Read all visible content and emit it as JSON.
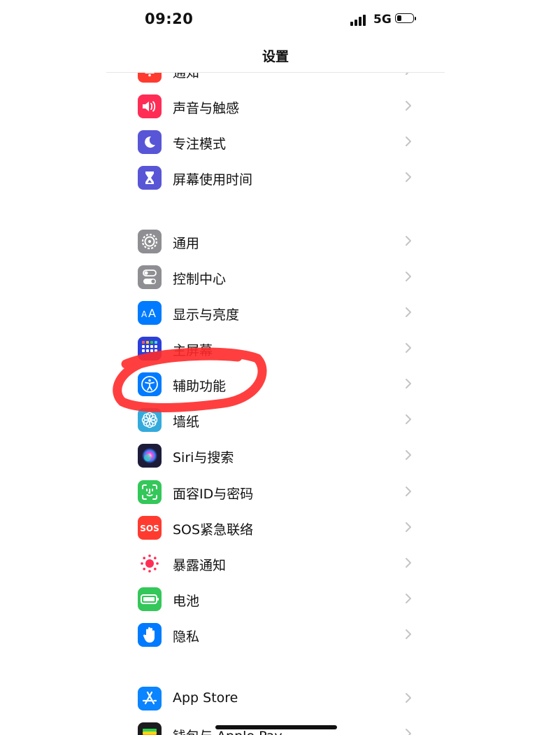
{
  "status_bar": {
    "time": "09:20",
    "network": "5G"
  },
  "nav": {
    "title": "设置"
  },
  "groups": [
    [
      {
        "name": "notifications",
        "label": "通知",
        "icon": "bell-icon",
        "color": "#ff3b30"
      },
      {
        "name": "sounds-haptics",
        "label": "声音与触感",
        "icon": "speaker-icon",
        "color": "#ff2d55"
      },
      {
        "name": "focus",
        "label": "专注模式",
        "icon": "moon-icon",
        "color": "#5856d6"
      },
      {
        "name": "screen-time",
        "label": "屏幕使用时间",
        "icon": "hourglass-icon",
        "color": "#5856d6"
      }
    ],
    [
      {
        "name": "general",
        "label": "通用",
        "icon": "gear-icon",
        "color": "#8e8e93"
      },
      {
        "name": "control-center",
        "label": "控制中心",
        "icon": "toggles-icon",
        "color": "#8e8e93"
      },
      {
        "name": "display-brightness",
        "label": "显示与亮度",
        "icon": "text-size-icon",
        "color": "#007aff"
      },
      {
        "name": "home-screen",
        "label": "主屏幕",
        "icon": "app-grid-icon",
        "color": "#2c3fd8"
      },
      {
        "name": "accessibility",
        "label": "辅助功能",
        "icon": "accessibility-icon",
        "color": "#007aff"
      },
      {
        "name": "wallpaper",
        "label": "墙纸",
        "icon": "flower-icon",
        "color": "#34aadc"
      },
      {
        "name": "siri-search",
        "label": "Siri与搜索",
        "icon": "siri-icon",
        "color": "#1c1c3a"
      },
      {
        "name": "face-id-passcode",
        "label": "面容ID与密码",
        "icon": "face-id-icon",
        "color": "#34c759"
      },
      {
        "name": "emergency-sos",
        "label": "SOS紧急联络",
        "icon": "sos-icon",
        "color": "#ff3b30"
      },
      {
        "name": "exposure-notifications",
        "label": "暴露通知",
        "icon": "exposure-icon",
        "color": "#ffffff"
      },
      {
        "name": "battery",
        "label": "电池",
        "icon": "battery-icon",
        "color": "#34c759"
      },
      {
        "name": "privacy",
        "label": "隐私",
        "icon": "hand-icon",
        "color": "#007aff"
      }
    ],
    [
      {
        "name": "app-store",
        "label": "App Store",
        "icon": "app-store-icon",
        "color": "#0a84ff"
      },
      {
        "name": "wallet-apple-pay",
        "label": "钱包与 Apple Pay",
        "icon": "wallet-icon",
        "color": "#1c1c1e"
      }
    ]
  ],
  "annotation": {
    "kind": "hand-drawn-circle",
    "target": "accessibility",
    "color": "#ff2a2a"
  }
}
